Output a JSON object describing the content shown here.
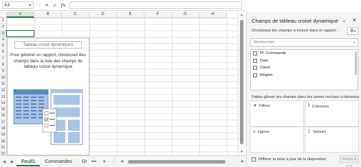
{
  "formula_bar": {
    "name_box": "A3",
    "fx_label": "fx",
    "cancel_glyph": "✕",
    "confirm_glyph": "✓",
    "formula_value": ""
  },
  "grid": {
    "columns": [
      "A",
      "B",
      "C",
      "D",
      "E",
      "F",
      "G",
      "H"
    ],
    "rows": [
      "1",
      "2",
      "3",
      "4",
      "5",
      "6",
      "7",
      "8",
      "9",
      "10",
      "11",
      "12",
      "13",
      "14",
      "15",
      "16",
      "17",
      "18",
      "19",
      "20",
      "21",
      "22"
    ],
    "active_column": "A",
    "active_row": "3"
  },
  "pivot_placeholder": {
    "title": "Tableau croisé dynamique1",
    "description": "Pour générer un rapport, choisissez des champs dans la liste des champs de tableau croisé dynamique"
  },
  "sheet_tabs": {
    "tabs": [
      "Feuil1",
      "Commandes",
      "Gr"
    ],
    "active_tab": "Feuil1",
    "more_label": "•••",
    "add_label": "+"
  },
  "field_pane": {
    "title": "Champs de tableau croisé dynamique",
    "choose_label": "Choisissez les champs à inclure dans le rapport :",
    "search_placeholder": "Rechercher",
    "fields": [
      "N° Commande",
      "Date",
      "Client",
      "Région"
    ],
    "drag_label": "Faites glisser les champs dans les zones voulues ci-dessous :",
    "zones": {
      "filters": "Filtres",
      "columns": "Colonnes",
      "rows": "Lignes",
      "values": "Valeurs"
    },
    "defer_label": "Différer la mise à jour de la disposition",
    "update_label": "Mettre à jour"
  },
  "colors": {
    "excel_green": "#1e7145",
    "active_header_bg": "#d9e8d9",
    "illustration_blue": "#a9c4e4",
    "illustration_blue_dark": "#5b85bd"
  },
  "icons": {
    "search": "search-icon",
    "gear": "gear-icon",
    "filter": "filter-icon",
    "columns": "columns-icon",
    "rows": "rows-icon",
    "values": "sigma-icon",
    "close": "close-icon",
    "collapse": "chevron-down-icon"
  }
}
